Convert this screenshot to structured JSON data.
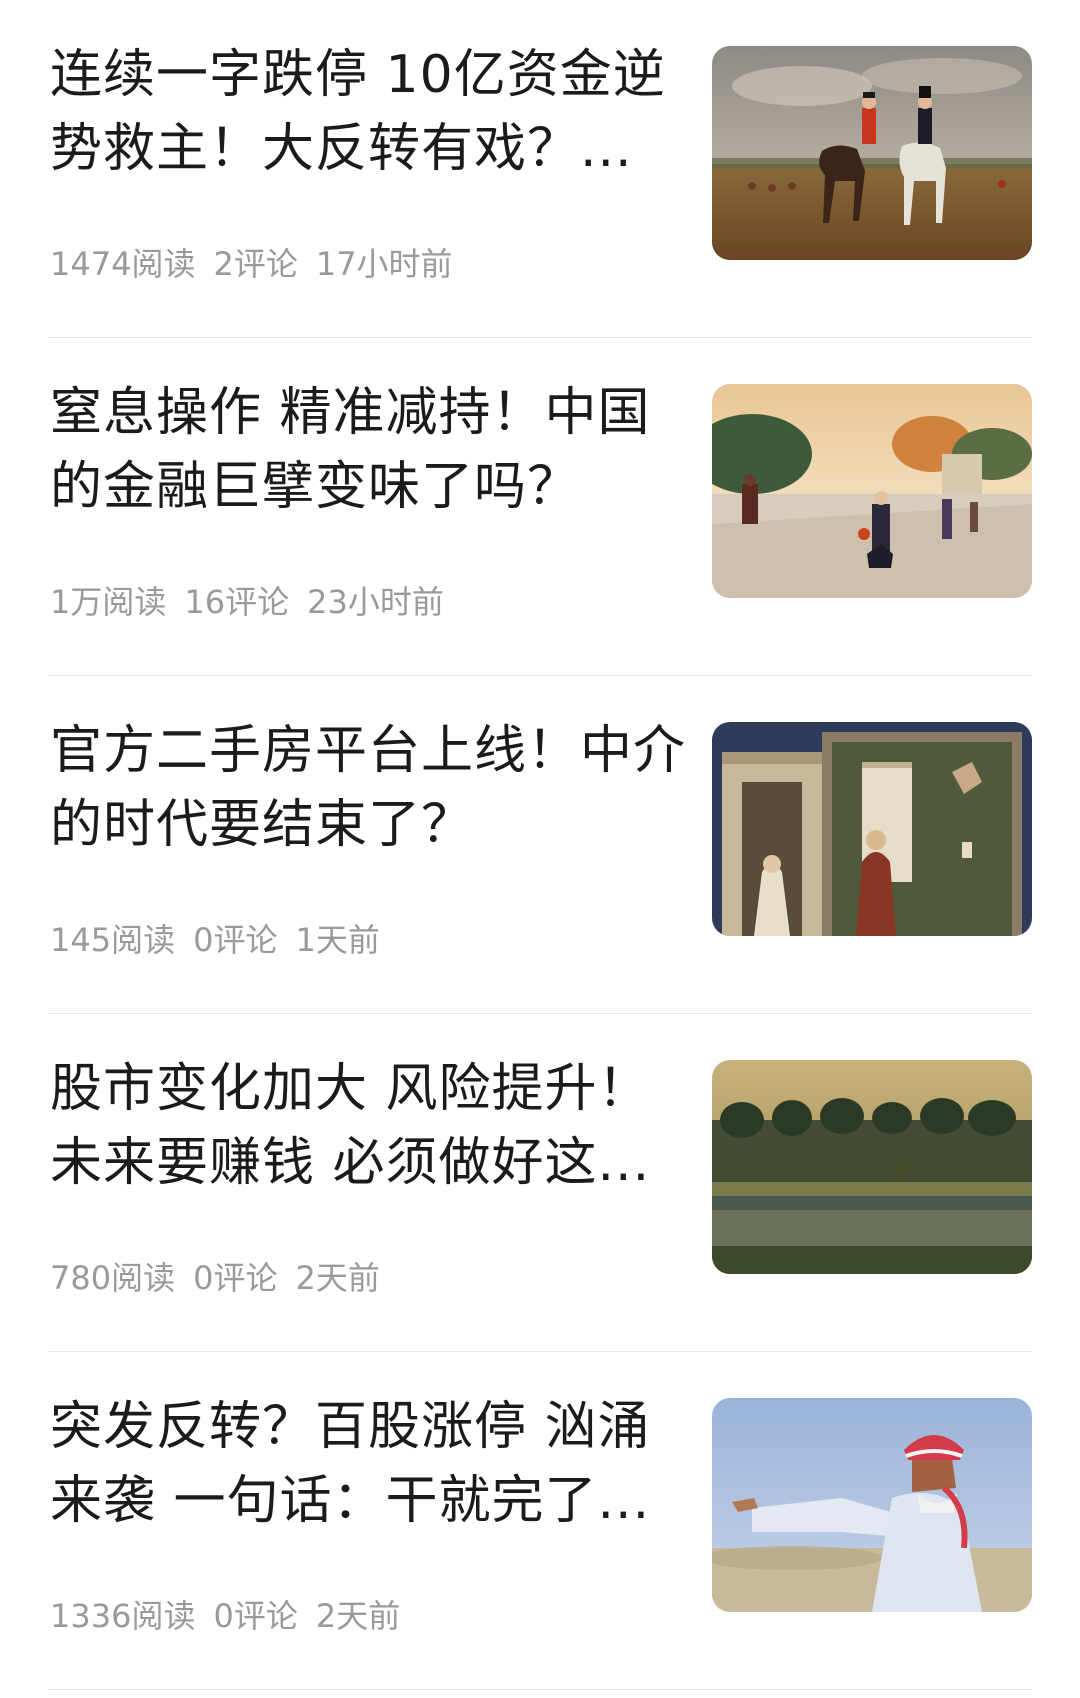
{
  "articles": [
    {
      "title": "连续一字跌停 10亿资金逆势救主！大反转有戏？...",
      "reads": "1474阅读",
      "comments": "2评论",
      "time": "17小时前",
      "thumbnail_icon": "horse-riders-painting-icon"
    },
    {
      "title": "窒息操作 精准减持！中国的金融巨擘变味了吗？",
      "reads": "1万阅读",
      "comments": "16评论",
      "time": "23小时前",
      "thumbnail_icon": "paris-street-painting-icon"
    },
    {
      "title": "官方二手房平台上线！中介的时代要结束了？",
      "reads": "145阅读",
      "comments": "0评论",
      "time": "1天前",
      "thumbnail_icon": "annunciation-fresco-icon"
    },
    {
      "title": "股市变化加大 风险提升！未来要赚钱 必须做好这...",
      "reads": "780阅读",
      "comments": "0评论",
      "time": "2天前",
      "thumbnail_icon": "sunset-trees-painting-icon"
    },
    {
      "title": "突发反转？百股涨停 汹涌来袭 一句话：干就完了...",
      "reads": "1336阅读",
      "comments": "0评论",
      "time": "2天前",
      "thumbnail_icon": "pointing-man-painting-icon"
    }
  ]
}
